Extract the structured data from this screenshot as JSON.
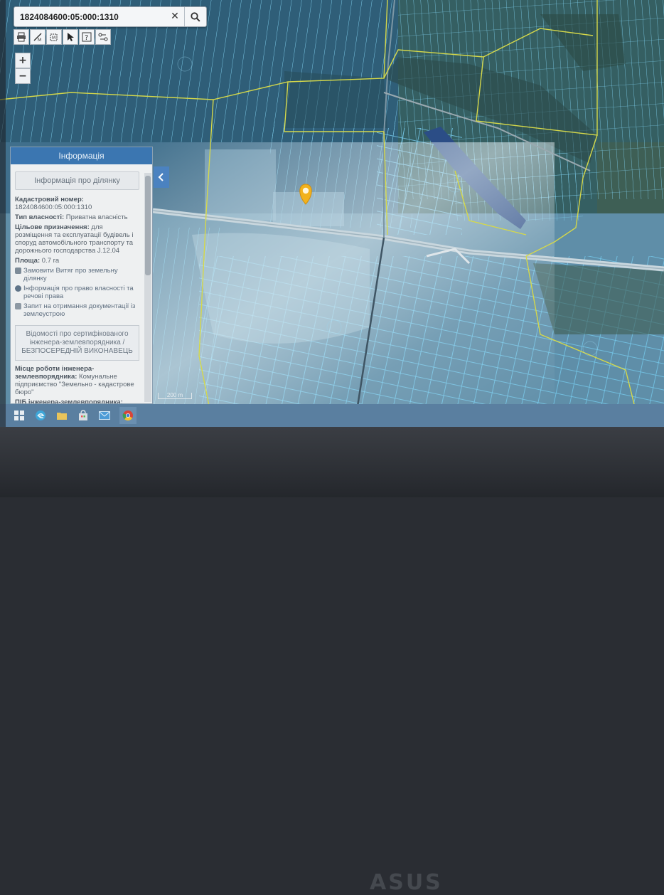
{
  "search": {
    "value": "1824084600:05:000:1310"
  },
  "toolbar": {
    "tools": [
      "print-icon",
      "measure-distance-icon",
      "measure-area-icon",
      "pointer-icon",
      "help-icon",
      "layers-icon"
    ]
  },
  "zoom": {
    "in": "+",
    "out": "−"
  },
  "info_panel": {
    "title": "Інформація",
    "subtitle": "Інформація про ділянку",
    "cadastral_label": "Кадастровий номер:",
    "cadastral_value": "1824084600:05:000:1310",
    "ownership_label": "Тип власності:",
    "ownership_value": "Приватна власність",
    "purpose_label": "Цільове призначення:",
    "purpose_value": "для розміщення та експлуатації будівель і споруд автомобільного транспорту та дорожнього господарства J.12.04",
    "area_label": "Площа:",
    "area_value": "0.7 га",
    "links": [
      "Замовити Витяг про земельну ділянку",
      "Інформація про право власності та речові права",
      "Запит на отримання документації із землеустрою"
    ],
    "cert_box": "Відомості про сертифікованого інженера-землевпорядника / БЕЗПОСЕРЕДНІЙ ВИКОНАВЕЦЬ",
    "workplace_label": "Місце роботи інженера-землевпорядника:",
    "workplace_value": "Комунальне підприємство \"Земельно - кадастрове бюро\"",
    "pib_label": "ПІБ інженера-землевпорядника:"
  },
  "scale_label": "200 m",
  "brand": "ASUS",
  "colors": {
    "header_blue": "#3b76b1",
    "parcel_line": "#62c6e8",
    "boundary_line": "#d5d84a",
    "marker": "#f2b21c"
  }
}
